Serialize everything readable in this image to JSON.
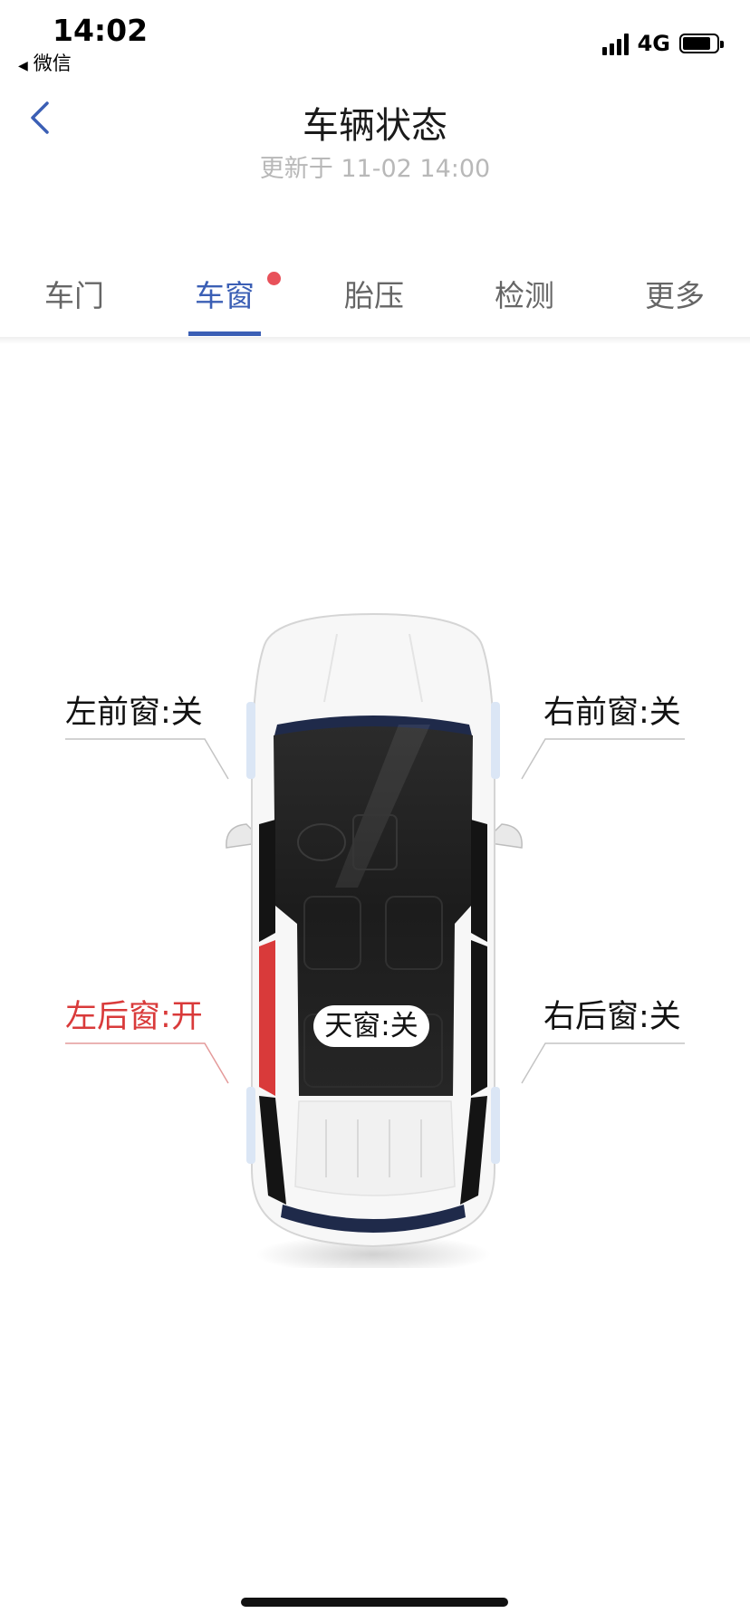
{
  "status_bar": {
    "time": "14:02",
    "back_app": "微信",
    "network": "4G"
  },
  "header": {
    "title": "车辆状态",
    "update_time": "更新于 11-02 14:00"
  },
  "tabs": [
    {
      "label": "车门"
    },
    {
      "label": "车窗",
      "active": true,
      "badge": true
    },
    {
      "label": "胎压"
    },
    {
      "label": "检测"
    },
    {
      "label": "更多"
    }
  ],
  "windows": {
    "front_left": {
      "label": "左前窗:关",
      "open": false
    },
    "front_right": {
      "label": "右前窗:关",
      "open": false
    },
    "rear_left": {
      "label": "左后窗:开",
      "open": true
    },
    "rear_right": {
      "label": "右后窗:关",
      "open": false
    },
    "sunroof": {
      "label": "天窗:关",
      "open": false
    }
  },
  "colors": {
    "accent": "#3b5fb5",
    "open_status": "#d93a3a",
    "badge": "#e8515a",
    "line": "#c4c4c4"
  }
}
